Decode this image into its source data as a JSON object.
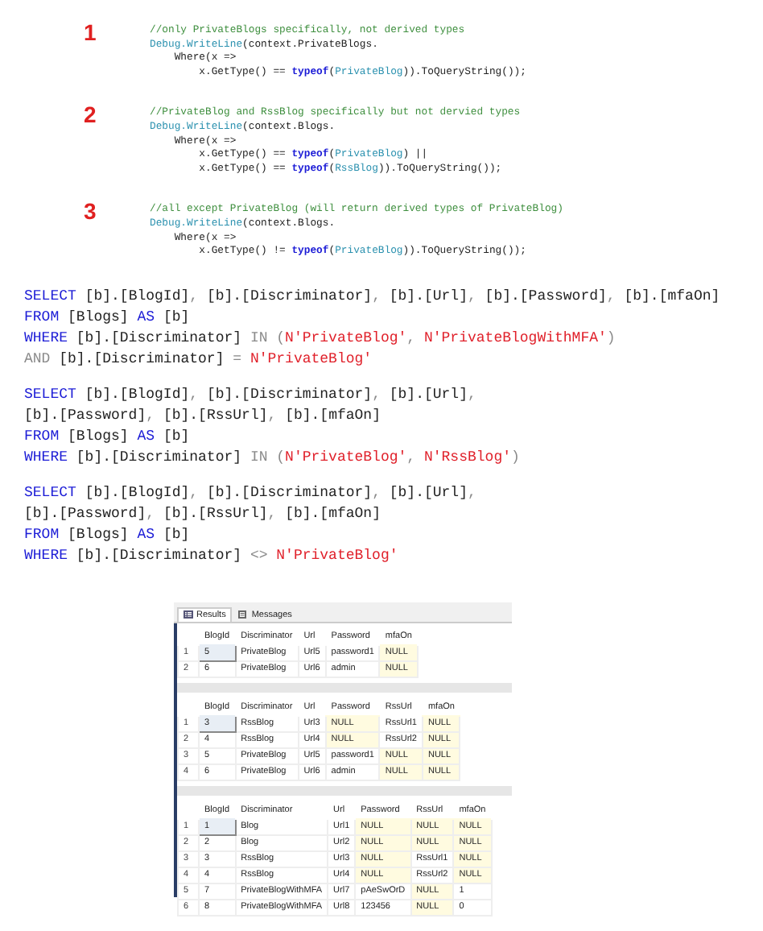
{
  "code_snippets": [
    {
      "number": "1",
      "lines": [
        [
          {
            "kind": "comment",
            "text": "//only PrivateBlogs specifically, not derived types"
          }
        ],
        [
          {
            "kind": "type",
            "text": "Debug.WriteLine"
          },
          {
            "kind": "plain",
            "text": "(context.PrivateBlogs."
          }
        ],
        [
          {
            "kind": "plain",
            "text": "    Where(x =>"
          }
        ],
        [
          {
            "kind": "plain",
            "text": "        x.GetType() == "
          },
          {
            "kind": "keyword",
            "text": "typeof"
          },
          {
            "kind": "plain",
            "text": "("
          },
          {
            "kind": "type",
            "text": "PrivateBlog"
          },
          {
            "kind": "plain",
            "text": ")).ToQueryString());"
          }
        ]
      ]
    },
    {
      "number": "2",
      "lines": [
        [
          {
            "kind": "comment",
            "text": "//PrivateBlog and RssBlog specifically but not dervied types"
          }
        ],
        [
          {
            "kind": "type",
            "text": "Debug.WriteLine"
          },
          {
            "kind": "plain",
            "text": "(context.Blogs."
          }
        ],
        [
          {
            "kind": "plain",
            "text": "    Where(x =>"
          }
        ],
        [
          {
            "kind": "plain",
            "text": "        x.GetType() == "
          },
          {
            "kind": "keyword",
            "text": "typeof"
          },
          {
            "kind": "plain",
            "text": "("
          },
          {
            "kind": "type",
            "text": "PrivateBlog"
          },
          {
            "kind": "plain",
            "text": ") ||"
          }
        ],
        [
          {
            "kind": "plain",
            "text": "        x.GetType() == "
          },
          {
            "kind": "keyword",
            "text": "typeof"
          },
          {
            "kind": "plain",
            "text": "("
          },
          {
            "kind": "type",
            "text": "RssBlog"
          },
          {
            "kind": "plain",
            "text": ")).ToQueryString());"
          }
        ]
      ]
    },
    {
      "number": "3",
      "lines": [
        [
          {
            "kind": "comment",
            "text": "//all except PrivateBlog (will return derived types of PrivateBlog)"
          }
        ],
        [
          {
            "kind": "type",
            "text": "Debug.WriteLine"
          },
          {
            "kind": "plain",
            "text": "(context.Blogs."
          }
        ],
        [
          {
            "kind": "plain",
            "text": "    Where(x =>"
          }
        ],
        [
          {
            "kind": "plain",
            "text": "        x.GetType() != "
          },
          {
            "kind": "keyword",
            "text": "typeof"
          },
          {
            "kind": "plain",
            "text": "("
          },
          {
            "kind": "type",
            "text": "PrivateBlog"
          },
          {
            "kind": "plain",
            "text": ")).ToQueryString());"
          }
        ]
      ]
    }
  ],
  "sql_queries": [
    {
      "lines": [
        [
          {
            "kind": "keyword",
            "text": "SELECT "
          },
          {
            "kind": "plain",
            "text": "[b].[BlogId]"
          },
          {
            "kind": "operator",
            "text": ", "
          },
          {
            "kind": "plain",
            "text": "[b].[Discriminator]"
          },
          {
            "kind": "operator",
            "text": ", "
          },
          {
            "kind": "plain",
            "text": "[b].[Url]"
          },
          {
            "kind": "operator",
            "text": ", "
          },
          {
            "kind": "plain",
            "text": "[b].[Password]"
          },
          {
            "kind": "operator",
            "text": ", "
          },
          {
            "kind": "plain",
            "text": "[b].[mfaOn]"
          }
        ],
        [
          {
            "kind": "keyword",
            "text": "FROM "
          },
          {
            "kind": "plain",
            "text": "[Blogs] "
          },
          {
            "kind": "keyword",
            "text": "AS "
          },
          {
            "kind": "plain",
            "text": "[b]"
          }
        ],
        [
          {
            "kind": "keyword",
            "text": "WHERE "
          },
          {
            "kind": "plain",
            "text": "[b].[Discriminator] "
          },
          {
            "kind": "operator",
            "text": "IN ("
          },
          {
            "kind": "string",
            "text": "N'PrivateBlog'"
          },
          {
            "kind": "operator",
            "text": ", "
          },
          {
            "kind": "string",
            "text": "N'PrivateBlogWithMFA'"
          },
          {
            "kind": "operator",
            "text": ")"
          }
        ],
        [
          {
            "kind": "operator",
            "text": "AND "
          },
          {
            "kind": "plain",
            "text": "[b].[Discriminator] "
          },
          {
            "kind": "operator",
            "text": "= "
          },
          {
            "kind": "string",
            "text": "N'PrivateBlog'"
          }
        ]
      ]
    },
    {
      "lines": [
        [
          {
            "kind": "keyword",
            "text": "SELECT "
          },
          {
            "kind": "plain",
            "text": "[b].[BlogId]"
          },
          {
            "kind": "operator",
            "text": ", "
          },
          {
            "kind": "plain",
            "text": "[b].[Discriminator]"
          },
          {
            "kind": "operator",
            "text": ", "
          },
          {
            "kind": "plain",
            "text": "[b].[Url]"
          },
          {
            "kind": "operator",
            "text": ","
          }
        ],
        [
          {
            "kind": "plain",
            "text": "[b].[Password]"
          },
          {
            "kind": "operator",
            "text": ", "
          },
          {
            "kind": "plain",
            "text": "[b].[RssUrl]"
          },
          {
            "kind": "operator",
            "text": ", "
          },
          {
            "kind": "plain",
            "text": "[b].[mfaOn]"
          }
        ],
        [
          {
            "kind": "keyword",
            "text": "FROM "
          },
          {
            "kind": "plain",
            "text": "[Blogs] "
          },
          {
            "kind": "keyword",
            "text": "AS "
          },
          {
            "kind": "plain",
            "text": "[b]"
          }
        ],
        [
          {
            "kind": "keyword",
            "text": "WHERE "
          },
          {
            "kind": "plain",
            "text": "[b].[Discriminator] "
          },
          {
            "kind": "operator",
            "text": "IN ("
          },
          {
            "kind": "string",
            "text": "N'PrivateBlog'"
          },
          {
            "kind": "operator",
            "text": ", "
          },
          {
            "kind": "string",
            "text": "N'RssBlog'"
          },
          {
            "kind": "operator",
            "text": ")"
          }
        ]
      ]
    },
    {
      "lines": [
        [
          {
            "kind": "keyword",
            "text": "SELECT "
          },
          {
            "kind": "plain",
            "text": "[b].[BlogId]"
          },
          {
            "kind": "operator",
            "text": ", "
          },
          {
            "kind": "plain",
            "text": "[b].[Discriminator]"
          },
          {
            "kind": "operator",
            "text": ", "
          },
          {
            "kind": "plain",
            "text": "[b].[Url]"
          },
          {
            "kind": "operator",
            "text": ","
          }
        ],
        [
          {
            "kind": "plain",
            "text": "[b].[Password]"
          },
          {
            "kind": "operator",
            "text": ", "
          },
          {
            "kind": "plain",
            "text": "[b].[RssUrl]"
          },
          {
            "kind": "operator",
            "text": ", "
          },
          {
            "kind": "plain",
            "text": "[b].[mfaOn]"
          }
        ],
        [
          {
            "kind": "keyword",
            "text": "FROM "
          },
          {
            "kind": "plain",
            "text": "[Blogs] "
          },
          {
            "kind": "keyword",
            "text": "AS "
          },
          {
            "kind": "plain",
            "text": "[b]"
          }
        ],
        [
          {
            "kind": "keyword",
            "text": "WHERE "
          },
          {
            "kind": "plain",
            "text": "[b].[Discriminator] "
          },
          {
            "kind": "operator",
            "text": "<> "
          },
          {
            "kind": "string",
            "text": "N'PrivateBlog'"
          }
        ]
      ]
    }
  ],
  "results": {
    "tabs": [
      {
        "label": "Results",
        "selected": true
      },
      {
        "label": "Messages",
        "selected": false
      }
    ],
    "grids": [
      {
        "columns": [
          "BlogId",
          "Discriminator",
          "Url",
          "Password",
          "mfaOn"
        ],
        "rows": [
          {
            "number": "1",
            "selected": true,
            "cells": [
              {
                "text": "5",
                "null": false
              },
              {
                "text": "PrivateBlog",
                "null": false
              },
              {
                "text": "Url5",
                "null": false
              },
              {
                "text": "password1",
                "null": false
              },
              {
                "text": "NULL",
                "null": true
              }
            ]
          },
          {
            "number": "2",
            "selected": false,
            "cells": [
              {
                "text": "6",
                "null": false
              },
              {
                "text": "PrivateBlog",
                "null": false
              },
              {
                "text": "Url6",
                "null": false
              },
              {
                "text": "admin",
                "null": false
              },
              {
                "text": "NULL",
                "null": true
              }
            ]
          }
        ]
      },
      {
        "columns": [
          "BlogId",
          "Discriminator",
          "Url",
          "Password",
          "RssUrl",
          "mfaOn"
        ],
        "rows": [
          {
            "number": "1",
            "selected": true,
            "cells": [
              {
                "text": "3",
                "null": false
              },
              {
                "text": "RssBlog",
                "null": false
              },
              {
                "text": "Url3",
                "null": false
              },
              {
                "text": "NULL",
                "null": true
              },
              {
                "text": "RssUrl1",
                "null": false
              },
              {
                "text": "NULL",
                "null": true
              }
            ]
          },
          {
            "number": "2",
            "selected": false,
            "cells": [
              {
                "text": "4",
                "null": false
              },
              {
                "text": "RssBlog",
                "null": false
              },
              {
                "text": "Url4",
                "null": false
              },
              {
                "text": "NULL",
                "null": true
              },
              {
                "text": "RssUrl2",
                "null": false
              },
              {
                "text": "NULL",
                "null": true
              }
            ]
          },
          {
            "number": "3",
            "selected": false,
            "cells": [
              {
                "text": "5",
                "null": false
              },
              {
                "text": "PrivateBlog",
                "null": false
              },
              {
                "text": "Url5",
                "null": false
              },
              {
                "text": "password1",
                "null": false
              },
              {
                "text": "NULL",
                "null": true
              },
              {
                "text": "NULL",
                "null": true
              }
            ]
          },
          {
            "number": "4",
            "selected": false,
            "cells": [
              {
                "text": "6",
                "null": false
              },
              {
                "text": "PrivateBlog",
                "null": false
              },
              {
                "text": "Url6",
                "null": false
              },
              {
                "text": "admin",
                "null": false
              },
              {
                "text": "NULL",
                "null": true
              },
              {
                "text": "NULL",
                "null": true
              }
            ]
          }
        ]
      },
      {
        "columns": [
          "BlogId",
          "Discriminator",
          "Url",
          "Password",
          "RssUrl",
          "mfaOn"
        ],
        "rows": [
          {
            "number": "1",
            "selected": true,
            "cells": [
              {
                "text": "1",
                "null": false
              },
              {
                "text": "Blog",
                "null": false
              },
              {
                "text": "Url1",
                "null": false
              },
              {
                "text": "NULL",
                "null": true
              },
              {
                "text": "NULL",
                "null": true
              },
              {
                "text": "NULL",
                "null": true
              }
            ]
          },
          {
            "number": "2",
            "selected": false,
            "cells": [
              {
                "text": "2",
                "null": false
              },
              {
                "text": "Blog",
                "null": false
              },
              {
                "text": "Url2",
                "null": false
              },
              {
                "text": "NULL",
                "null": true
              },
              {
                "text": "NULL",
                "null": true
              },
              {
                "text": "NULL",
                "null": true
              }
            ]
          },
          {
            "number": "3",
            "selected": false,
            "cells": [
              {
                "text": "3",
                "null": false
              },
              {
                "text": "RssBlog",
                "null": false
              },
              {
                "text": "Url3",
                "null": false
              },
              {
                "text": "NULL",
                "null": true
              },
              {
                "text": "RssUrl1",
                "null": false
              },
              {
                "text": "NULL",
                "null": true
              }
            ]
          },
          {
            "number": "4",
            "selected": false,
            "cells": [
              {
                "text": "4",
                "null": false
              },
              {
                "text": "RssBlog",
                "null": false
              },
              {
                "text": "Url4",
                "null": false
              },
              {
                "text": "NULL",
                "null": true
              },
              {
                "text": "RssUrl2",
                "null": false
              },
              {
                "text": "NULL",
                "null": true
              }
            ]
          },
          {
            "number": "5",
            "selected": false,
            "cells": [
              {
                "text": "7",
                "null": false
              },
              {
                "text": "PrivateBlogWithMFA",
                "null": false
              },
              {
                "text": "Url7",
                "null": false
              },
              {
                "text": "pAeSwOrD",
                "null": false
              },
              {
                "text": "NULL",
                "null": true
              },
              {
                "text": "1",
                "null": false
              }
            ]
          },
          {
            "number": "6",
            "selected": false,
            "cells": [
              {
                "text": "8",
                "null": false
              },
              {
                "text": "PrivateBlogWithMFA",
                "null": false
              },
              {
                "text": "Url8",
                "null": false
              },
              {
                "text": "123456",
                "null": false
              },
              {
                "text": "NULL",
                "null": true
              },
              {
                "text": "0",
                "null": false
              }
            ]
          }
        ]
      }
    ]
  }
}
